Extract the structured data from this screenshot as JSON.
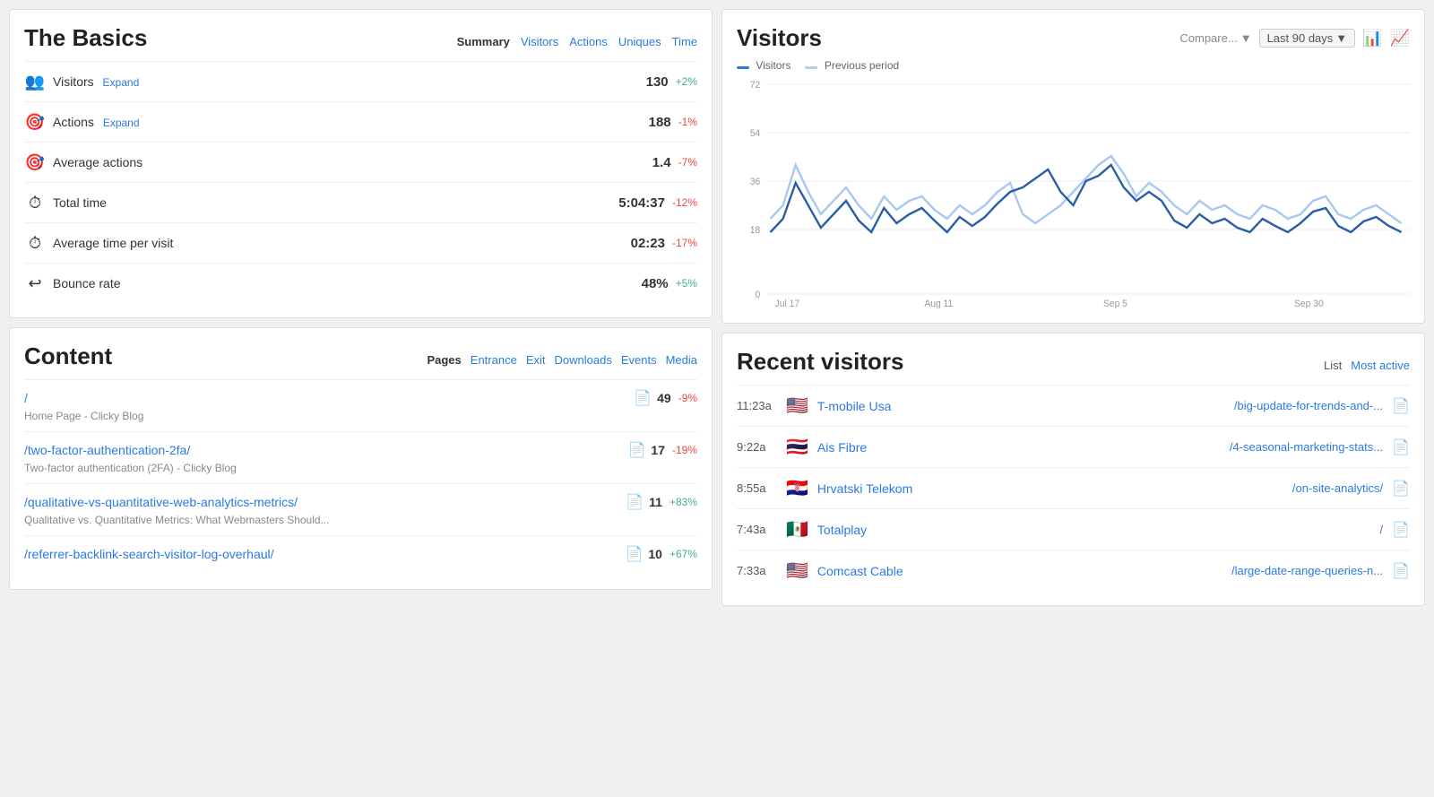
{
  "basics": {
    "title": "The Basics",
    "tabs": {
      "summary": "Summary",
      "visitors": "Visitors",
      "actions": "Actions",
      "uniques": "Uniques",
      "time": "Time"
    },
    "rows": [
      {
        "icon": "👥",
        "label": "Visitors",
        "hasExpand": true,
        "expandText": "Expand",
        "value": "130",
        "change": "+2%",
        "positive": true
      },
      {
        "icon": "🎯",
        "label": "Actions",
        "hasExpand": true,
        "expandText": "Expand",
        "value": "188",
        "change": "-1%",
        "positive": false
      },
      {
        "icon": "🎯",
        "label": "Average actions",
        "hasExpand": false,
        "value": "1.4",
        "change": "-7%",
        "positive": false
      },
      {
        "icon": "⏱",
        "label": "Total time",
        "hasExpand": false,
        "value": "5:04:37",
        "change": "-12%",
        "positive": false
      },
      {
        "icon": "⏱",
        "label": "Average time per visit",
        "hasExpand": false,
        "value": "02:23",
        "change": "-17%",
        "positive": false
      },
      {
        "icon": "↩",
        "label": "Bounce rate",
        "hasExpand": false,
        "value": "48%",
        "change": "+5%",
        "positive": true
      }
    ]
  },
  "content": {
    "title": "Content",
    "tabs": {
      "pages": "Pages",
      "entrance": "Entrance",
      "exit": "Exit",
      "downloads": "Downloads",
      "events": "Events",
      "media": "Media"
    },
    "rows": [
      {
        "link": "/",
        "count": "49",
        "change": "-9%",
        "positive": false,
        "subtitle": "Home Page - Clicky Blog"
      },
      {
        "link": "/two-factor-authentication-2fa/",
        "count": "17",
        "change": "-19%",
        "positive": false,
        "subtitle": "Two-factor authentication (2FA) - Clicky Blog"
      },
      {
        "link": "/qualitative-vs-quantitative-web-analytics-metrics/",
        "count": "11",
        "change": "+83%",
        "positive": true,
        "subtitle": "Qualitative vs. Quantitative Metrics: What Webmasters Should..."
      },
      {
        "link": "/referrer-backlink-search-visitor-log-overhaul/",
        "count": "10",
        "change": "+67%",
        "positive": true,
        "subtitle": ""
      }
    ]
  },
  "visitors_chart": {
    "title": "Visitors",
    "compare_label": "Compare...",
    "period_label": "Last 90 days",
    "legend": {
      "visitors": "Visitors",
      "previous": "Previous period"
    },
    "y_labels": [
      "72",
      "54",
      "36",
      "18",
      "0"
    ],
    "x_labels": [
      "Jul 17",
      "Aug 11",
      "Sep 5",
      "Sep 30"
    ]
  },
  "recent_visitors": {
    "title": "Recent visitors",
    "tabs": {
      "list": "List",
      "most_active": "Most active"
    },
    "rows": [
      {
        "time": "11:23a",
        "flag": "🇺🇸",
        "isp": "T-mobile Usa",
        "page": "/big-update-for-trends-and-..."
      },
      {
        "time": "9:22a",
        "flag": "🇹🇭",
        "isp": "Ais Fibre",
        "page": "/4-seasonal-marketing-stats..."
      },
      {
        "time": "8:55a",
        "flag": "🇭🇷",
        "isp": "Hrvatski Telekom",
        "page": "/on-site-analytics/"
      },
      {
        "time": "7:43a",
        "flag": "🇲🇽",
        "isp": "Totalplay",
        "page": "/"
      },
      {
        "time": "7:33a",
        "flag": "🇺🇸",
        "isp": "Comcast Cable",
        "page": "/large-date-range-queries-n..."
      }
    ]
  }
}
